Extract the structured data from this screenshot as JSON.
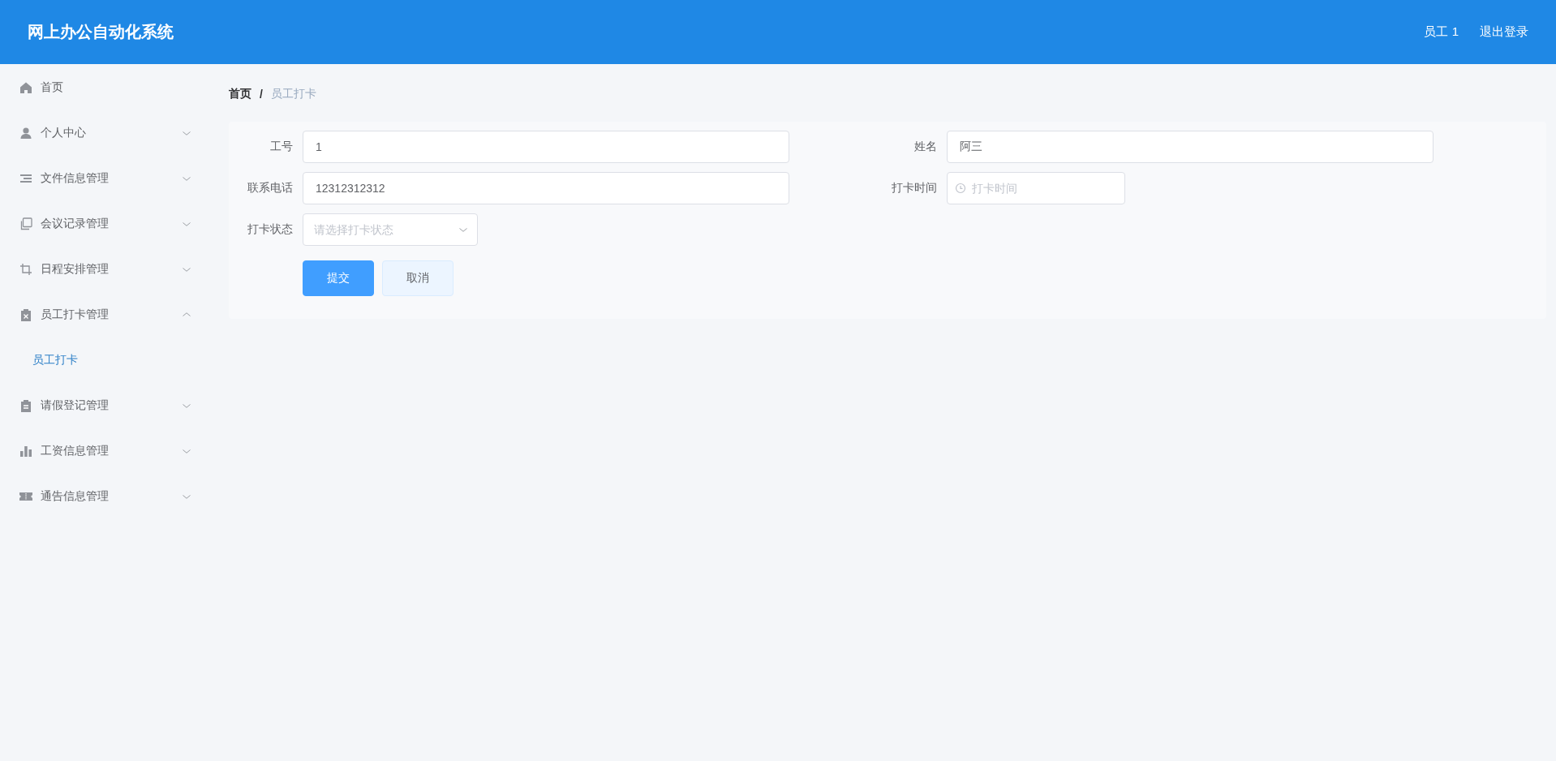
{
  "header": {
    "title": "网上办公自动化系统",
    "user": "员工 1",
    "logout": "退出登录"
  },
  "sidebar": {
    "items": [
      {
        "label": "首页",
        "kind": "link"
      },
      {
        "label": "个人中心",
        "kind": "submenu",
        "expanded": false
      },
      {
        "label": "文件信息管理",
        "kind": "submenu",
        "expanded": false
      },
      {
        "label": "会议记录管理",
        "kind": "submenu",
        "expanded": false
      },
      {
        "label": "日程安排管理",
        "kind": "submenu",
        "expanded": false
      },
      {
        "label": "员工打卡管理",
        "kind": "submenu",
        "expanded": true,
        "children": [
          {
            "label": "员工打卡",
            "selected": true
          }
        ]
      },
      {
        "label": "请假登记管理",
        "kind": "submenu",
        "expanded": false
      },
      {
        "label": "工资信息管理",
        "kind": "submenu",
        "expanded": false
      },
      {
        "label": "通告信息管理",
        "kind": "submenu",
        "expanded": false
      }
    ]
  },
  "breadcrumb": [
    {
      "label": "首页",
      "current": false
    },
    {
      "label": "/",
      "current": false
    },
    {
      "label": "员工打卡",
      "current": true
    }
  ],
  "form": {
    "fields": [
      {
        "label": "工号",
        "kind": "text",
        "value": "1"
      },
      {
        "label": "姓名",
        "kind": "text",
        "value": "阿三"
      },
      {
        "label": "联系电话",
        "kind": "text",
        "value": "12312312312"
      },
      {
        "label": "打卡时间",
        "kind": "time",
        "placeholder": "打卡时间"
      },
      {
        "label": "打卡状态",
        "kind": "select",
        "placeholder": "请选择打卡状态"
      }
    ],
    "buttons": [
      {
        "label": "提交",
        "kind": "primary"
      },
      {
        "label": "取消",
        "kind": "default"
      }
    ]
  }
}
